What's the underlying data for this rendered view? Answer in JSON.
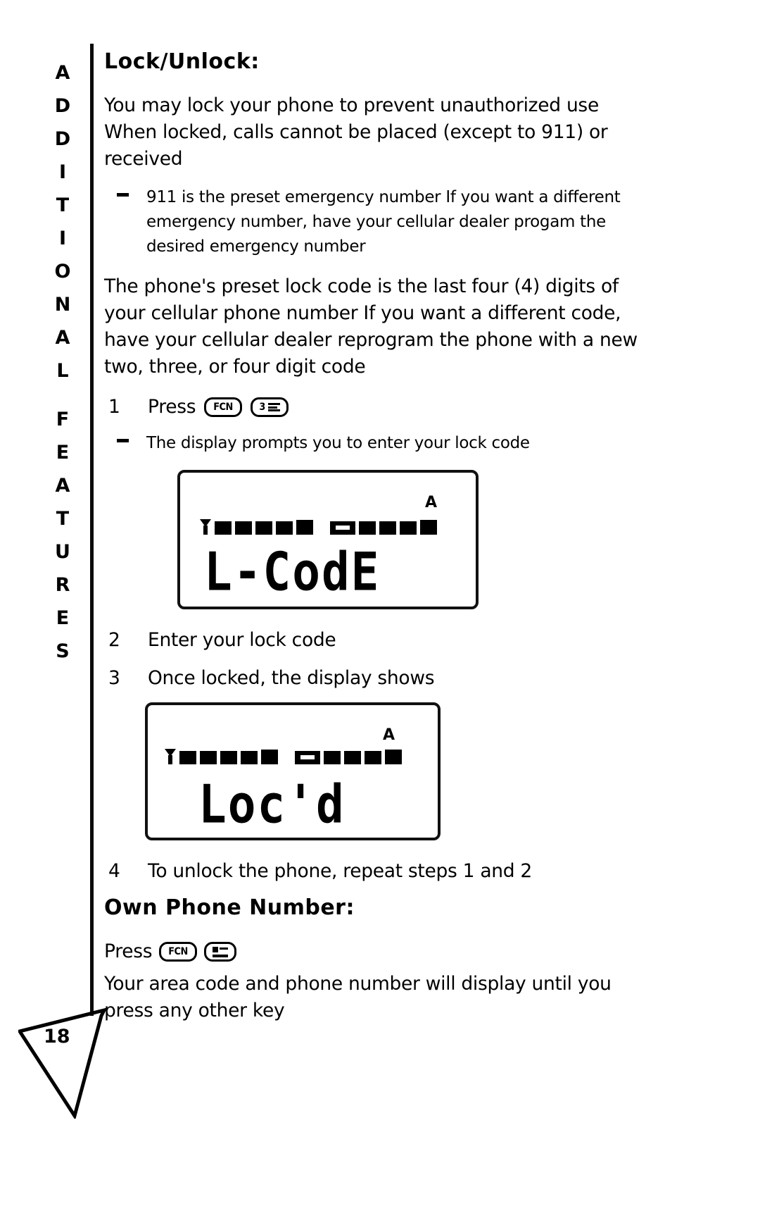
{
  "page": {
    "number": "18",
    "side_tab_text": "ADDITIONAL FEATURES",
    "side_tab_letters": [
      "A",
      "D",
      "D",
      "I",
      "T",
      "I",
      "O",
      "N",
      "A",
      "L",
      "",
      "F",
      "E",
      "A",
      "T",
      "U",
      "R",
      "E",
      "S"
    ]
  },
  "sections": [
    {
      "heading": "Lock/Unlock:",
      "heading_first_letter": "L",
      "heading_rest": "ock/",
      "heading_second_letter": "U",
      "heading_tail": "nlock:"
    }
  ],
  "lock_section": {
    "heading": "Lock/Unlock:",
    "intro_paragraph": "You may lock your phone to prevent unauthorized use  When locked, calls cannot be placed (except to 911) or received",
    "bullet": "911 is the preset emergency number  If you want a different emergency number, have your cellular dealer progam the desired emergency number",
    "code_paragraph": "The phone's preset lock code is the last four (4) digits of your cellular phone number  If you want a different code, have your cellular dealer reprogram the phone with a new two, three, or four digit code",
    "steps": [
      {
        "num": "1",
        "text": "Press",
        "keys": [
          "FCN",
          "3"
        ]
      },
      {
        "num": "2",
        "text": "Enter your lock code",
        "keys": []
      },
      {
        "num": "3",
        "text": "Once locked, the display shows",
        "keys": []
      },
      {
        "num": "4",
        "text": "To unlock the phone, repeat steps 1 and 2",
        "keys": []
      }
    ],
    "step1_substep": "The display prompts you to enter your lock code"
  },
  "lcd_displays": [
    {
      "id": "lcd-code",
      "text": "L-CodE",
      "roam_indicator": "A",
      "signal_bars": 5,
      "battery_bars": 4,
      "antenna_icon": "antenna-icon",
      "battery_icon": "battery-icon"
    },
    {
      "id": "lcd-locked",
      "text": "Loc'd",
      "roam_indicator": "A",
      "signal_bars": 5,
      "battery_bars": 4,
      "antenna_icon": "antenna-icon",
      "battery_icon": "battery-icon"
    }
  ],
  "own_phone_section": {
    "heading": "Own Phone Number:",
    "press_word": "Press",
    "keys": [
      "FCN",
      "#"
    ],
    "text": "Your area code and phone number will display until you press any other key"
  },
  "colors": {
    "ink": "#000000",
    "paper": "#ffffff"
  }
}
